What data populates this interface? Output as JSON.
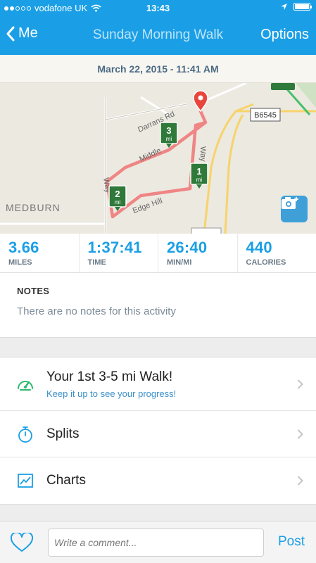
{
  "status_bar": {
    "carrier": "vodafone UK",
    "time": "13:43",
    "signal_bars_filled": 2,
    "signal_bars_total": 5,
    "battery_fill": 1.0
  },
  "nav": {
    "back_label": "Me",
    "title": "Sunday Morning Walk",
    "options_label": "Options"
  },
  "date_banner": "March 22, 2015 - 11:41 AM",
  "map": {
    "place_label": "MEDBURN",
    "road_labels": [
      "Darrans Rd",
      "Middle",
      "Edge Hill",
      "B6545",
      "Way",
      "Way"
    ],
    "mile_markers": [
      {
        "value": "1",
        "unit": "mi"
      },
      {
        "value": "2",
        "unit": "mi"
      },
      {
        "value": "3",
        "unit": "mi"
      }
    ],
    "route_color": "#f07a7a",
    "pin_color": "#e8453c",
    "marker_color": "#2f7a3a"
  },
  "stats": [
    {
      "value": "3.66",
      "label": "MILES"
    },
    {
      "value": "1:37:41",
      "label": "TIME"
    },
    {
      "value": "26:40",
      "label": "MIN/MI"
    },
    {
      "value": "440",
      "label": "CALORIES"
    }
  ],
  "notes": {
    "heading": "NOTES",
    "text": "There are no notes for this activity"
  },
  "menu": [
    {
      "icon": "speedometer-icon",
      "title": "Your 1st 3-5 mi Walk!",
      "subtitle": "Keep it up to see your progress!"
    },
    {
      "icon": "stopwatch-icon",
      "title": "Splits"
    },
    {
      "icon": "chart-icon",
      "title": "Charts"
    }
  ],
  "comment_bar": {
    "placeholder": "Write a comment...",
    "post_label": "Post"
  },
  "colors": {
    "accent": "#1a9fe6",
    "icon_green": "#2dbb6e"
  }
}
